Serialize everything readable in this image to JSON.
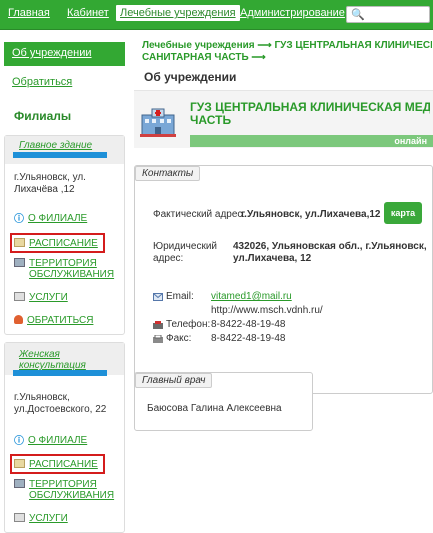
{
  "topnav": {
    "items": [
      "Главная",
      "Кабинет",
      "Лечебные учреждения",
      "Администрирование"
    ],
    "search_icon": "search-icon"
  },
  "sidebar": {
    "about_tab": "Об учреждении",
    "contact_link": "Обратиться",
    "branches_title": "Филиалы",
    "branches": [
      {
        "name": "Главное здание",
        "address": [
          "г.Ульяновск, ул.",
          "Лихачёва ,12"
        ],
        "links": [
          "О ФИЛИАЛЕ",
          "РАСПИСАНИЕ",
          "ТЕРРИТОРИЯ",
          "ОБСЛУЖИВАНИЯ",
          "УСЛУГИ",
          "ОБРАТИТЬСЯ"
        ]
      },
      {
        "name": [
          "Женская",
          "консультация"
        ],
        "address": [
          "г.Ульяновск,",
          "ул.Достоевского, 22"
        ],
        "links": [
          "О ФИЛИАЛЕ",
          "РАСПИСАНИЕ",
          "ТЕРРИТОРИЯ",
          "ОБСЛУЖИВАНИЯ",
          "УСЛУГИ"
        ]
      }
    ]
  },
  "breadcrumb": {
    "line1": "Лечебные учреждения ⟶ ГУЗ ЦЕНТРАЛЬНАЯ КЛИНИЧЕСКАЯ",
    "line2": "САНИТАРНАЯ ЧАСТЬ ⟶"
  },
  "page_title": "Об учреждении",
  "org": {
    "name_line1": "ГУЗ ЦЕНТРАЛЬНАЯ КЛИНИЧЕСКАЯ МЕДИК",
    "name_line2": "ЧАСТЬ",
    "status": "онлайн"
  },
  "contacts": {
    "label": "Контакты",
    "actual_label": "Фактический адрес:",
    "actual_value": "г.Ульяновск, ул.Лихачева,12",
    "map_button": "карта",
    "legal_label": [
      "Юридический",
      "адрес:"
    ],
    "legal_value": [
      "432026, Ульяновская обл., г.Ульяновск,",
      "ул.Лихачева, 12"
    ],
    "email_label": "Email:",
    "email_value": "vitamed1@mail.ru",
    "website": "http://www.msch.vdnh.ru/",
    "phone_label": "Телефон:",
    "phone_value": "8-8422-48-19-48",
    "fax_label": "Факс:",
    "fax_value": "8-8422-48-19-48"
  },
  "chief": {
    "label": "Главный врач",
    "name": "Баюсова Галина Алексеевна"
  },
  "colors": {
    "brand_green": "#33a833",
    "highlight_red": "#d41c1c",
    "marker_blue": "#1e90d8"
  }
}
